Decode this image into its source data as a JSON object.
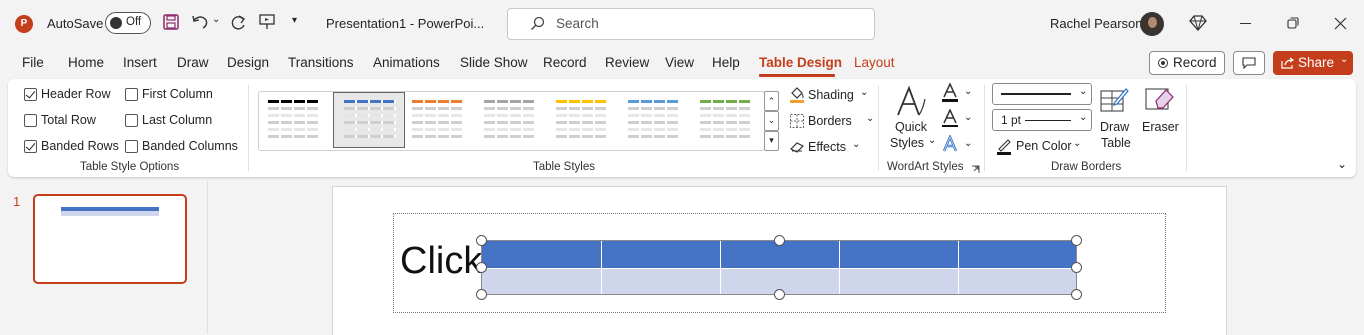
{
  "titlebar": {
    "autosave_label": "AutoSave",
    "autosave_state": "Off",
    "doc_title": "Presentation1  -  PowerPoi...",
    "search_placeholder": "Search",
    "user_name": "Rachel Pearson"
  },
  "tabs": [
    "File",
    "Home",
    "Insert",
    "Draw",
    "Design",
    "Transitions",
    "Animations",
    "Slide Show",
    "Record",
    "Review",
    "View",
    "Help",
    "Table Design",
    "Layout"
  ],
  "active_tab": "Table Design",
  "actions": {
    "record_label": "Record",
    "share_label": "Share"
  },
  "ribbon": {
    "table_style_options": {
      "label": "Table Style Options",
      "options": [
        {
          "label": "Header Row",
          "checked": true
        },
        {
          "label": "Total Row",
          "checked": false
        },
        {
          "label": "Banded Rows",
          "checked": true
        },
        {
          "label": "First Column",
          "checked": false
        },
        {
          "label": "Last Column",
          "checked": false
        },
        {
          "label": "Banded Columns",
          "checked": false
        }
      ]
    },
    "table_styles": {
      "label": "Table Styles",
      "style_colors": [
        "#000000",
        "#4472c4",
        "#ed7d31",
        "#a5a5a5",
        "#ffc000",
        "#5b9bd5",
        "#70ad47"
      ],
      "shading_label": "Shading",
      "borders_label": "Borders",
      "effects_label": "Effects"
    },
    "wordart_styles": {
      "label": "WordArt Styles",
      "quick_styles_line1": "Quick",
      "quick_styles_line2": "Styles"
    },
    "draw_borders": {
      "label": "Draw Borders",
      "pen_weight": "1 pt",
      "pen_color_label": "Pen Color",
      "draw_table_line1": "Draw",
      "draw_table_line2": "Table",
      "eraser_label": "Eraser"
    }
  },
  "slides_pane": {
    "slide_number": "1"
  },
  "slide": {
    "placeholder_text": "Click"
  },
  "colors": {
    "accent": "#c43e1c",
    "table_header": "#4472c4",
    "table_band": "#cfd5ea"
  }
}
